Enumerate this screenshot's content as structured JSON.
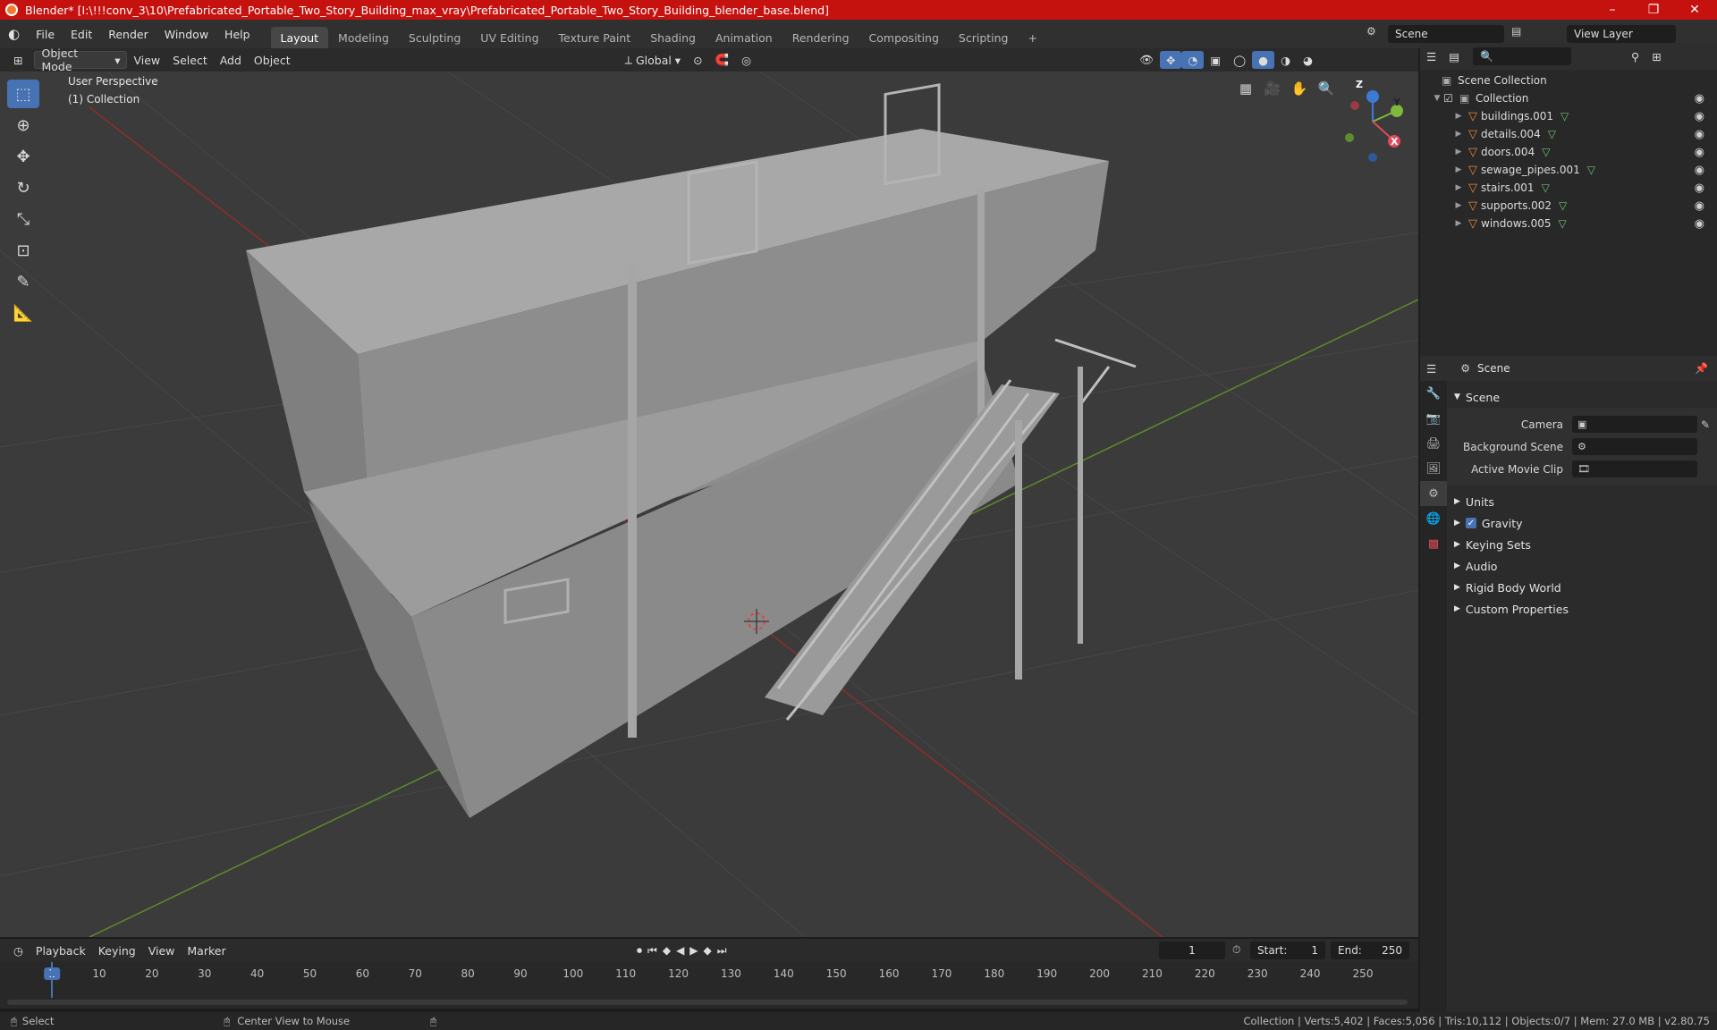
{
  "window": {
    "title": "Blender* [I:\\!!!conv_3\\10\\Prefabricated_Portable_Two_Story_Building_max_vray\\Prefabricated_Portable_Two_Story_Building_blender_base.blend]",
    "minimize": "–",
    "maximize": "❐",
    "close": "✕"
  },
  "menus": [
    "File",
    "Edit",
    "Render",
    "Window",
    "Help"
  ],
  "workspaces": [
    "Layout",
    "Modeling",
    "Sculpting",
    "UV Editing",
    "Texture Paint",
    "Shading",
    "Animation",
    "Rendering",
    "Compositing",
    "Scripting"
  ],
  "add_workspace": "+",
  "scene_field": "Scene",
  "view_layer_field": "View Layer",
  "viewport_header": {
    "mode": "Object Mode",
    "menus": [
      "View",
      "Select",
      "Add",
      "Object"
    ],
    "transform_orientation": "Global"
  },
  "viewport": {
    "perspective_label": "User Perspective",
    "collection_label": "(1) Collection",
    "gizmo": {
      "z": "Z",
      "y": "Y",
      "x": "X"
    }
  },
  "outliner": {
    "root": "Scene Collection",
    "collection": "Collection",
    "items": [
      "buildings.001",
      "details.004",
      "doors.004",
      "sewage_pipes.001",
      "stairs.001",
      "supports.002",
      "windows.005"
    ]
  },
  "properties": {
    "header": "Scene",
    "section": "Scene",
    "fields": [
      {
        "label": "Camera"
      },
      {
        "label": "Background Scene"
      },
      {
        "label": "Active Movie Clip"
      }
    ],
    "subsections": [
      "Units",
      "Gravity",
      "Keying Sets",
      "Audio",
      "Rigid Body World",
      "Custom Properties"
    ]
  },
  "timeline": {
    "menus": [
      "Playback",
      "Keying",
      "View",
      "Marker"
    ],
    "current_frame": "1",
    "start_label": "Start:",
    "start": "1",
    "end_label": "End:",
    "end": "250",
    "ticks": [
      "1",
      "10",
      "20",
      "30",
      "40",
      "50",
      "60",
      "70",
      "80",
      "90",
      "100",
      "110",
      "120",
      "130",
      "140",
      "150",
      "160",
      "170",
      "180",
      "190",
      "200",
      "210",
      "220",
      "230",
      "240",
      "250"
    ]
  },
  "status": {
    "left": "Select",
    "middle": "Center View to Mouse",
    "right": "Collection | Verts:5,402 | Faces:5,056 | Tris:10,112 | Objects:0/7 | Mem: 27.0 MB | v2.80.75"
  },
  "colors": {
    "accent": "#4772b3",
    "title_bar": "#c6120f",
    "mesh_icon": "#e8893a"
  }
}
